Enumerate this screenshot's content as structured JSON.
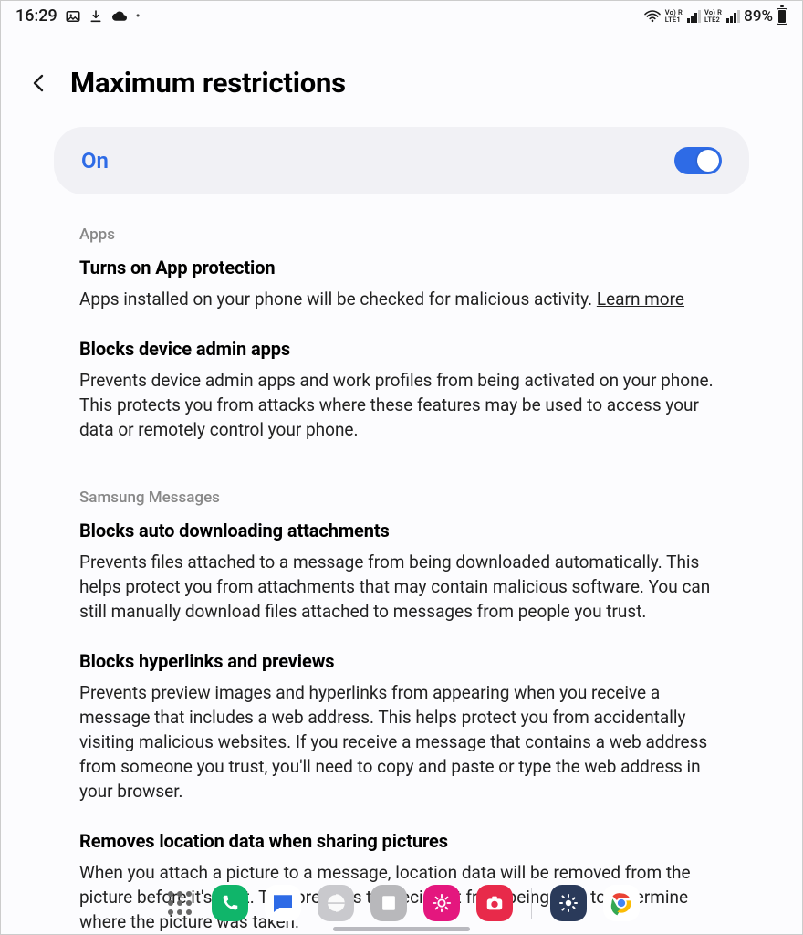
{
  "status": {
    "time": "16:29",
    "battery_pct": "89%",
    "net1": {
      "top": "Vo) R",
      "bot": "LTE1"
    },
    "net2": {
      "top": "Vo) R",
      "bot": "LTE2"
    }
  },
  "header": {
    "title": "Maximum restrictions"
  },
  "toggle": {
    "label": "On",
    "state": "on"
  },
  "groups": {
    "apps": {
      "title": "Apps",
      "item1": {
        "title": "Turns on App protection",
        "desc_a": "Apps installed on your phone will be checked for malicious activity. ",
        "learn_more": "Learn more"
      },
      "item2": {
        "title": "Blocks device admin apps",
        "desc": "Prevents device admin apps and work profiles from being activated on your phone. This protects you from attacks where these features may be used to access your data or remotely control your phone."
      }
    },
    "msgs": {
      "title": "Samsung Messages",
      "item1": {
        "title": "Blocks auto downloading attachments",
        "desc": "Prevents files attached to a message from being downloaded automatically. This helps protect you from attachments that may contain malicious software. You can still manually download files attached to messages from people you trust."
      },
      "item2": {
        "title": "Blocks hyperlinks and previews",
        "desc": "Prevents preview images and hyperlinks from appearing when you receive a message that includes a web address. This helps protect you from accidentally visiting malicious websites. If you receive a message that contains a web address from someone you trust, you'll need to copy and paste or type the web address in your browser."
      },
      "item3": {
        "title": "Removes location data when sharing pictures",
        "desc": "When you attach a picture to a message, location data will be removed from the picture before it's sent. This prevents the recipient from being able to determine where the picture was taken."
      }
    }
  },
  "dock": {
    "phone": "phone-app",
    "messages": "messages-app",
    "internet": "internet-app",
    "notes": "notes-app",
    "gallery": "gallery-app",
    "camera": "camera-app",
    "settings": "settings-app",
    "chrome": "chrome-app"
  }
}
